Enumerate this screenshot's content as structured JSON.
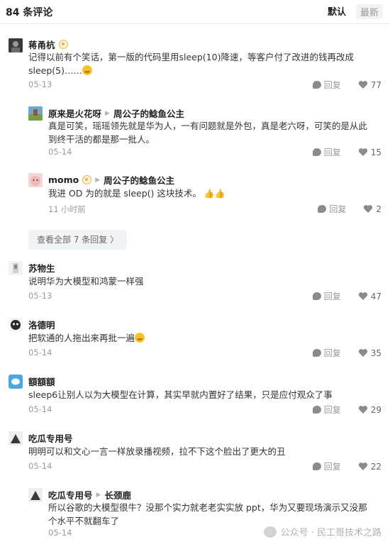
{
  "header": {
    "count_label": "84 条评论",
    "sort_default": "默认",
    "sort_latest": "最新"
  },
  "reply_label": "回复",
  "comments": [
    {
      "name": "蒋甬杭",
      "text_1": "记得以前有个笑话，第一版的代码里用sleep(10)降速，等客户付了改进的钱再改成",
      "text_2": "sleep(5)……",
      "date": "05-13",
      "likes": "77"
    },
    {
      "name": "原来是火花呀",
      "reply_to": "周公子的鲶鱼公主",
      "text_1": "真是可笑，瑶瑶领先就是华为人，一有问题就是外包，真是老六呀，可笑的是从此",
      "text_2": "到终干活的都是那一批人。",
      "date": "05-14",
      "likes": "15"
    },
    {
      "name": "momo",
      "reply_to": "周公子的鲶鱼公主",
      "text_1": "我进 OD 为的就是 sleep() 这块技术。",
      "date": "11 小时前",
      "likes": "2"
    },
    {
      "name": "苏物生",
      "text_1": "说明华为大模型和鸿蒙一样强",
      "date": "05-13",
      "likes": "47"
    },
    {
      "name": "洛德明",
      "text_1": "把软通的人拖出来再批一遍",
      "date": "05-14",
      "likes": "35"
    },
    {
      "name": "額額額",
      "text_1": "sleep6让别人以为大模型在计算，其实早就内置好了结果，只是应付观众了事",
      "date": "05-14",
      "likes": "29"
    },
    {
      "name": "吃瓜专用号",
      "text_1": "明明可以和文心一言一样放录播视频，拉不下这个脸出了更大的丑",
      "date": "05-14",
      "likes": "22"
    },
    {
      "name": "吃瓜专用号",
      "reply_to": "长颈鹿",
      "text_1": "所以谷歌的大模型很牛？没那个实力就老老实实放 ppt，华为又要现场演示又没那",
      "text_2": "个水平不就翻车了",
      "date": "05-14",
      "likes": "2"
    }
  ],
  "more_replies": "查看全部 7 条回复 〉",
  "watermark": "公众号 · 民工哥技术之路"
}
